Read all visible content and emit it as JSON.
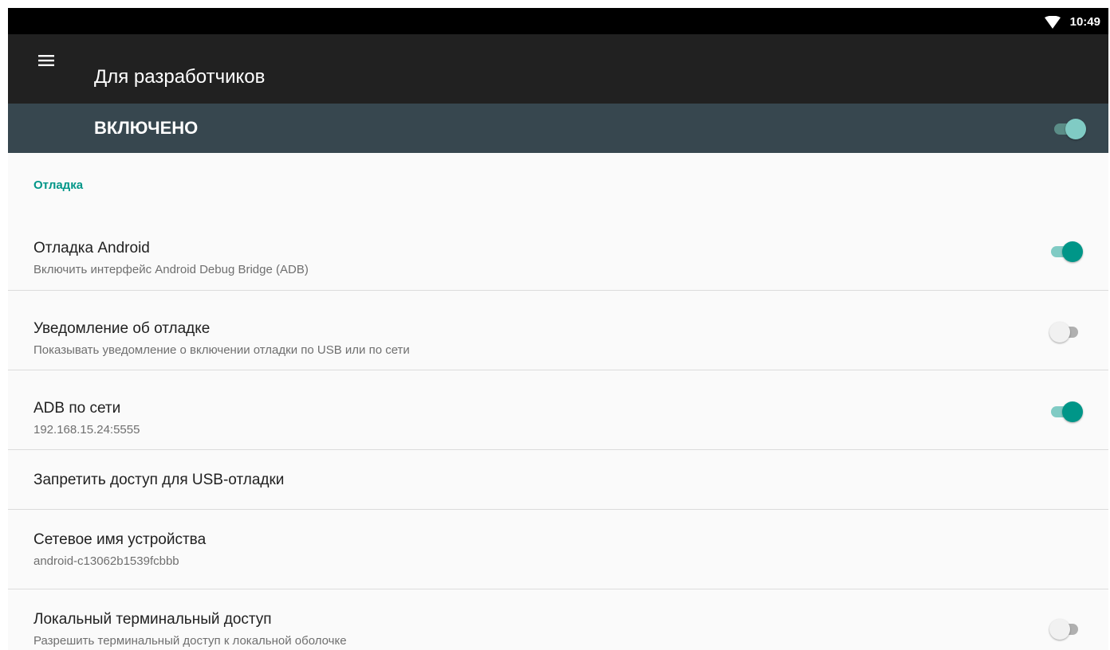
{
  "status_bar": {
    "time": "10:49",
    "wifi_icon": "wifi-icon"
  },
  "toolbar": {
    "title": "Для разработчиков",
    "menu_icon": "menu-icon"
  },
  "master_switch": {
    "label": "ВКЛЮЧЕНО",
    "checked": true
  },
  "section": {
    "header": "Отладка"
  },
  "settings": [
    {
      "title": "Отладка Android",
      "subtitle": "Включить интерфейс Android Debug Bridge (ADB)",
      "switch": true
    },
    {
      "title": "Уведомление об отладке",
      "subtitle": "Показывать уведомление о включении отладки по USB или по сети",
      "switch": false
    },
    {
      "title": "ADB по сети",
      "subtitle": "192.168.15.24:5555",
      "switch": true
    },
    {
      "title": "Запретить доступ для USB-отладки"
    },
    {
      "title": "Сетевое имя устройства",
      "subtitle": "android-c13062b1539fcbbb"
    },
    {
      "title": "Локальный терминальный доступ",
      "subtitle": "Разрешить терминальный доступ к локальной оболочке",
      "switch": false
    }
  ],
  "colors": {
    "accent": "#009688",
    "toolbar": "#212121",
    "master_bar": "#37474f",
    "status_bar": "#000000",
    "background": "#fafafa"
  }
}
